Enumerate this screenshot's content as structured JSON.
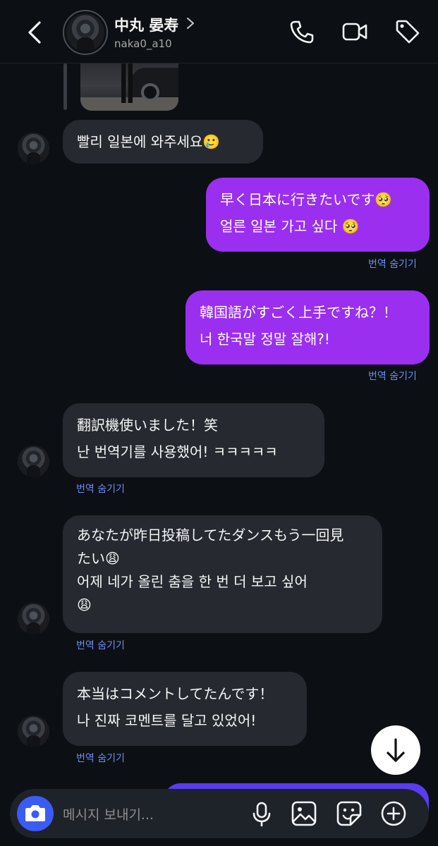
{
  "header": {
    "name": "中丸 晏寿",
    "username": "naka0_a10"
  },
  "messages": [
    {
      "lines": [
        "빨리 일본에 와주세요🥲"
      ]
    },
    {
      "lines": [
        "早く日本に行きたいです🥺",
        "얼른 일본 가고 싶다 🥺"
      ],
      "hide": "번역 숨기기"
    },
    {
      "lines": [
        "韓国語がすごく上手ですね？！",
        "너 한국말 정말 잘해?!"
      ],
      "hide": "번역 숨기기"
    },
    {
      "lines": [
        "翻訳機使いました！笑",
        "난 번역기를 사용했어! ㅋㅋㅋㅋㅋ"
      ],
      "hide": "번역 숨기기"
    },
    {
      "lines": [
        "あなたが昨日投稿してたダンスもう一回見",
        "たい😩",
        "어제 네가 올린 춤을 한 번 더 보고 싶어",
        "😩"
      ],
      "hide": "번역 숨기기"
    },
    {
      "lines": [
        "本当はコメントしてたんです！",
        "나 진짜 코멘트를 달고 있었어!"
      ],
      "hide": "번역 숨기기"
    }
  ],
  "composer": {
    "placeholder": "메시지 보내기..."
  },
  "colors": {
    "background": "#0c1014",
    "incoming_bubble": "#262a30",
    "outgoing_bubble": "#9a2ff0",
    "link": "#6f8cf5",
    "camera_button": "#3b5bf5"
  }
}
